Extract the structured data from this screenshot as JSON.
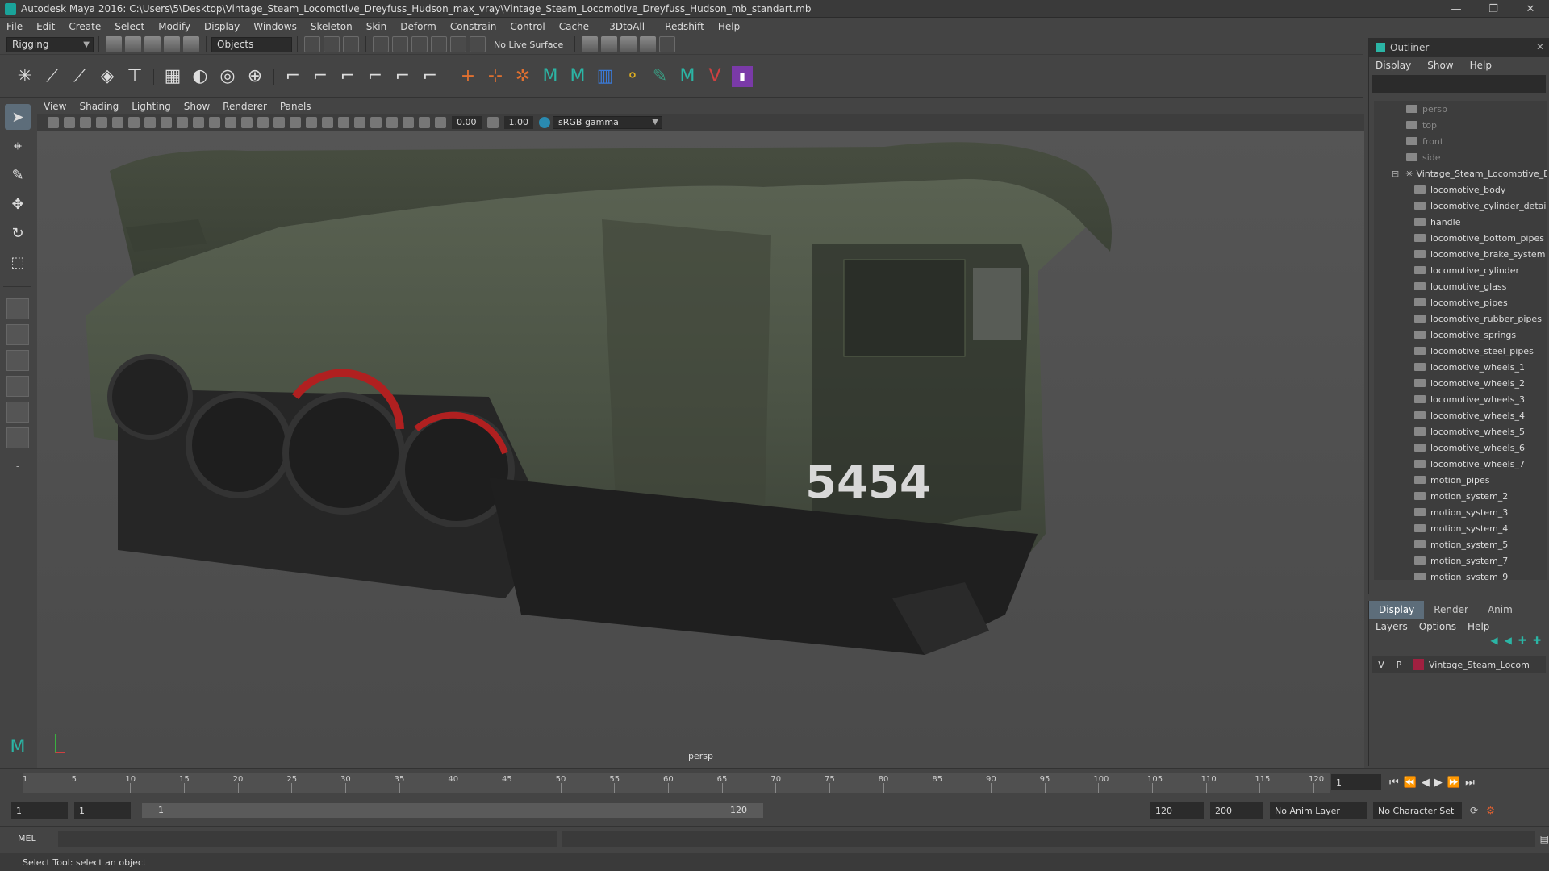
{
  "window": {
    "title": "Autodesk Maya 2016: C:\\Users\\5\\Desktop\\Vintage_Steam_Locomotive_Dreyfuss_Hudson_max_vray\\Vintage_Steam_Locomotive_Dreyfuss_Hudson_mb_standart.mb"
  },
  "menubar": [
    "File",
    "Edit",
    "Create",
    "Select",
    "Modify",
    "Display",
    "Windows",
    "Skeleton",
    "Skin",
    "Deform",
    "Constrain",
    "Control",
    "Cache",
    "- 3DtoAll -",
    "Redshift",
    "Help"
  ],
  "statusline": {
    "mode": "Rigging",
    "selection_mode": "Objects",
    "live_surface": "No Live Surface"
  },
  "viewport": {
    "menu": [
      "View",
      "Shading",
      "Lighting",
      "Show",
      "Renderer",
      "Panels"
    ],
    "field_a": "0.00",
    "field_b": "1.00",
    "color_space": "sRGB gamma",
    "camera_label": "persp",
    "number": "5454"
  },
  "outliner": {
    "title": "Outliner",
    "menu": [
      "Display",
      "Show",
      "Help"
    ],
    "items": [
      "persp",
      "top",
      "front",
      "side",
      "Vintage_Steam_Locomotive_D",
      "locomotive_body",
      "locomotive_cylinder_detai",
      "handle",
      "locomotive_bottom_pipes",
      "locomotive_brake_system",
      "locomotive_cylinder",
      "locomotive_glass",
      "locomotive_pipes",
      "locomotive_rubber_pipes",
      "locomotive_springs",
      "locomotive_steel_pipes",
      "locomotive_wheels_1",
      "locomotive_wheels_2",
      "locomotive_wheels_3",
      "locomotive_wheels_4",
      "locomotive_wheels_5",
      "locomotive_wheels_6",
      "locomotive_wheels_7",
      "motion_pipes",
      "motion_system_2",
      "motion_system_3",
      "motion_system_4",
      "motion_system_5",
      "motion_system_7",
      "motion_system_9"
    ]
  },
  "layers": {
    "tabs": [
      "Display",
      "Render",
      "Anim"
    ],
    "menu": [
      "Layers",
      "Options",
      "Help"
    ],
    "row": {
      "v": "V",
      "p": "P",
      "name": "Vintage_Steam_Locom"
    }
  },
  "timeline": {
    "ticks": [
      "5",
      "10",
      "15",
      "20",
      "25",
      "30",
      "35",
      "40",
      "45",
      "50",
      "55",
      "60",
      "65",
      "70",
      "75",
      "80",
      "85",
      "90",
      "95",
      "100",
      "105",
      "110",
      "115",
      "120"
    ],
    "start_tick": "1",
    "current": "1"
  },
  "range": {
    "start": "1",
    "inner_start": "1",
    "slider_start": "1",
    "slider_end": "120",
    "end": "120",
    "total": "200",
    "anim_layer": "No Anim Layer",
    "char_set": "No Character Set"
  },
  "cmd": {
    "label": "MEL"
  },
  "help": {
    "text": "Select Tool: select an object"
  }
}
